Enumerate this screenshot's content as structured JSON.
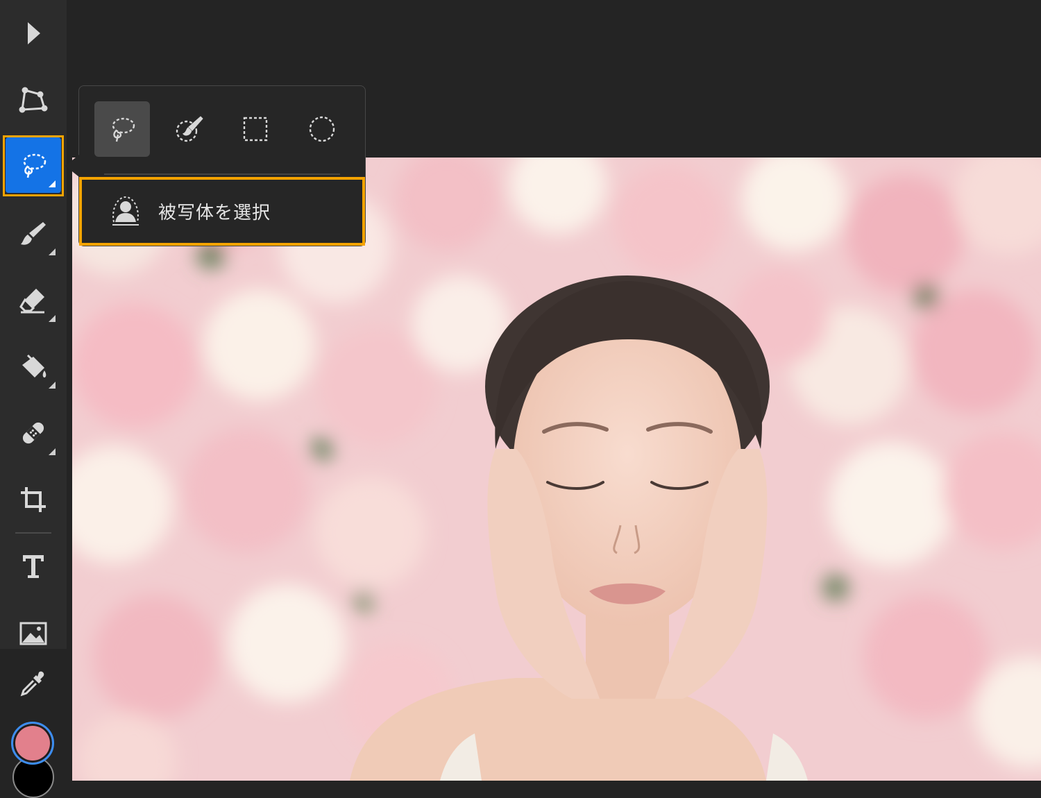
{
  "toolbar": {
    "tools": [
      {
        "name": "select-tool",
        "icon": "arrow-icon",
        "active": false
      },
      {
        "name": "transform-tool",
        "icon": "transform-icon",
        "active": false
      },
      {
        "name": "lasso-tool",
        "icon": "lasso-icon",
        "active": true
      },
      {
        "name": "brush-tool",
        "icon": "brush-icon",
        "active": false
      },
      {
        "name": "eraser-tool",
        "icon": "eraser-icon",
        "active": false
      },
      {
        "name": "fill-tool",
        "icon": "paint-bucket-icon",
        "active": false
      },
      {
        "name": "heal-tool",
        "icon": "bandage-icon",
        "active": false
      },
      {
        "name": "crop-tool",
        "icon": "crop-icon",
        "active": false
      },
      {
        "name": "type-tool",
        "icon": "type-icon",
        "active": false
      },
      {
        "name": "place-image-tool",
        "icon": "image-icon",
        "active": false
      },
      {
        "name": "eyedropper-tool",
        "icon": "eyedropper-icon",
        "active": false
      }
    ],
    "foreground_color": "#e2808c",
    "background_color": "#000000"
  },
  "popover": {
    "sub_tools": [
      {
        "name": "lasso",
        "icon": "lasso-icon",
        "selected": true
      },
      {
        "name": "quick-select",
        "icon": "quick-select-brush-icon",
        "selected": false
      },
      {
        "name": "rectangle-marquee",
        "icon": "rectangle-marquee-icon",
        "selected": false
      },
      {
        "name": "ellipse-marquee",
        "icon": "ellipse-marquee-icon",
        "selected": false
      }
    ],
    "select_subject_label": "被写体を選択"
  },
  "colors": {
    "accent": "#1473e6",
    "highlight": "#f5a300",
    "toolbar_bg": "#2c2c2c",
    "app_bg": "#242424"
  }
}
